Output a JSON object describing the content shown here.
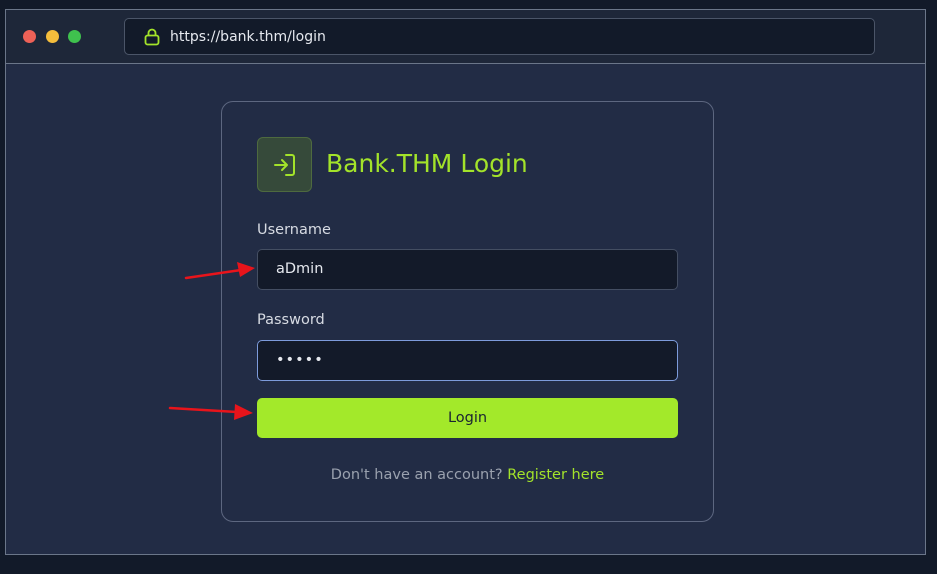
{
  "browser": {
    "url": "https://bank.thm/login"
  },
  "login": {
    "title": "Bank.THM Login",
    "username_label": "Username",
    "username_value": "aDmin",
    "password_label": "Password",
    "password_value": "•••••",
    "button_label": "Login",
    "footer_text": "Don't have an account? ",
    "register_link": "Register here"
  },
  "colors": {
    "accent": "#a3e32a",
    "background": "#222c45",
    "annotation_arrow": "#e8141b"
  },
  "icons": {
    "lock": "lock-icon",
    "login": "login-icon",
    "annotation": "red-arrow"
  }
}
